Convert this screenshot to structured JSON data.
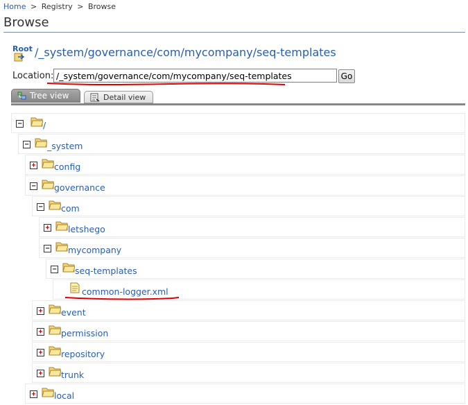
{
  "breadcrumb": {
    "home": "Home",
    "sep1": ">",
    "registry": "Registry",
    "sep2": ">",
    "browse": "Browse"
  },
  "page_title": "Browse",
  "root": {
    "link": "Root",
    "path": "/_system/governance/com/mycompany/seq-templates"
  },
  "location": {
    "label": "Location:",
    "value": "/_system/governance/com/mycompany/seq-templates",
    "go": "Go"
  },
  "tabs": {
    "tree": "Tree view",
    "detail": "Detail view"
  },
  "tree": {
    "root": "/",
    "system": "_system",
    "config": "config",
    "governance": "governance",
    "com": "com",
    "letshego": "letshego",
    "mycompany": "mycompany",
    "seq_templates": "seq-templates",
    "common_logger": "common-logger.xml",
    "event": "event",
    "permission": "permission",
    "repository": "repository",
    "trunk": "trunk",
    "local": "local"
  },
  "toggles": {
    "expand": "+",
    "collapse": "−"
  },
  "colors": {
    "link": "#2a5db0",
    "annotation": "#dd0000",
    "folder": "#f3d77a"
  }
}
